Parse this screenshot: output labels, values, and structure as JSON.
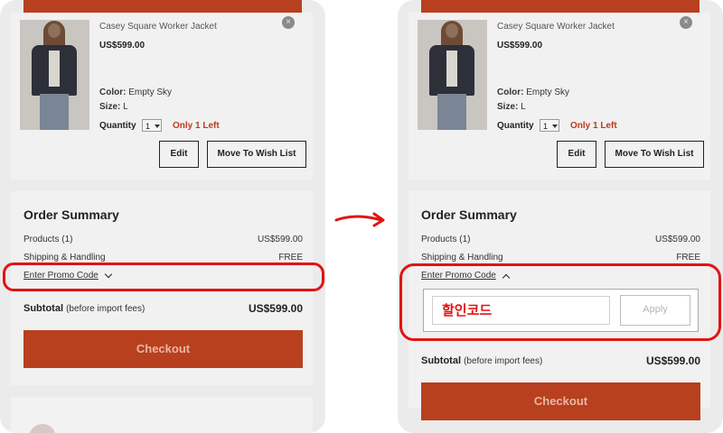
{
  "product": {
    "name": "Casey Square Worker Jacket",
    "price": "US$599.00",
    "color_label": "Color:",
    "color_value": "Empty Sky",
    "size_label": "Size:",
    "size_value": "L",
    "quantity_label": "Quantity",
    "quantity_value": "1",
    "stock_note": "Only 1 Left",
    "close_icon": "×",
    "edit_label": "Edit",
    "wishlist_label": "Move To Wish List"
  },
  "summary": {
    "title": "Order Summary",
    "products_label": "Products (1)",
    "products_value": "US$599.00",
    "shipping_label": "Shipping & Handling",
    "shipping_value": "FREE",
    "promo_label": "Enter Promo Code",
    "subtotal_label": "Subtotal",
    "subtotal_note": "(before import fees)",
    "subtotal_value": "US$599.00",
    "checkout_label": "Checkout"
  },
  "promo": {
    "input_value": "할인코드",
    "apply_label": "Apply"
  },
  "colors": {
    "accent": "#b8401e",
    "highlight": "#e31313",
    "stock": "#c0391b"
  }
}
